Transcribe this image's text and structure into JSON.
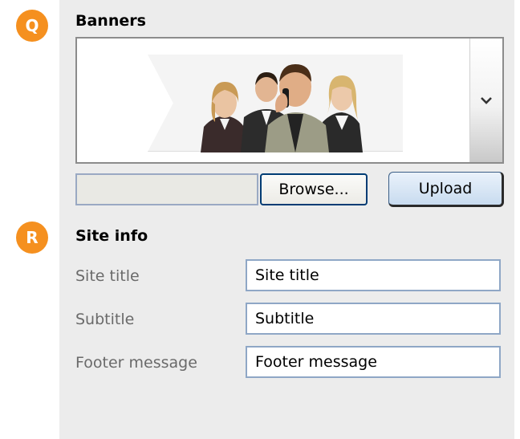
{
  "banners": {
    "marker": "Q",
    "heading": "Banners",
    "browse_label": "Browse...",
    "upload_label": "Upload",
    "file_path_value": ""
  },
  "site_info": {
    "marker": "R",
    "heading": "Site info",
    "fields": [
      {
        "label": "Site title",
        "value": "Site title"
      },
      {
        "label": "Subtitle",
        "value": "Subtitle"
      },
      {
        "label": "Footer message",
        "value": "Footer message"
      }
    ]
  },
  "colors": {
    "marker": "#f5901f",
    "panel": "#ececec",
    "input_border": "#8fa7c6"
  },
  "icons": {
    "dropdown": "chevron-down-icon"
  }
}
